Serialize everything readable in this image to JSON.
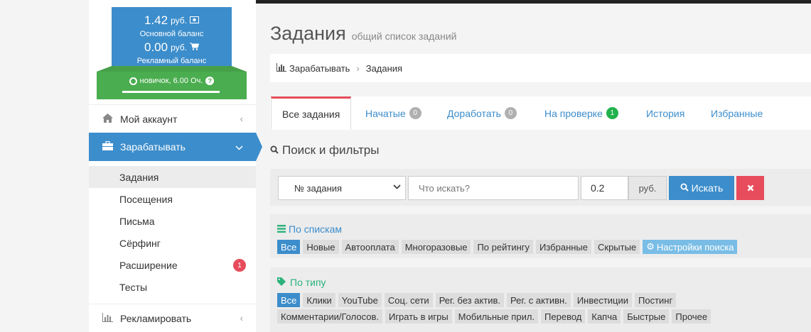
{
  "balance": {
    "main_amount": "1.42",
    "main_unit": "руб.",
    "main_label": "Основной баланс",
    "ad_amount": "0.00",
    "ad_unit": "руб.",
    "ad_label": "Рекламный баланс"
  },
  "level": {
    "text": "новичок, 6.00 Оч.",
    "progress": 0.0
  },
  "sidebar": {
    "account": "Мой аккаунт",
    "earn": "Зарабатывать",
    "advertise": "Рекламировать",
    "submenu": [
      {
        "label": "Задания",
        "active": true
      },
      {
        "label": "Посещения"
      },
      {
        "label": "Письма"
      },
      {
        "label": "Сёрфинг"
      },
      {
        "label": "Расширение",
        "badge": "1"
      },
      {
        "label": "Тесты"
      }
    ]
  },
  "page": {
    "title": "Задания",
    "subtitle": "общий список заданий"
  },
  "breadcrumb": {
    "root": "Зарабатывать",
    "current": "Задания"
  },
  "tabs": [
    {
      "label": "Все задания"
    },
    {
      "label": "Начатые",
      "badge": "0"
    },
    {
      "label": "Доработать",
      "badge": "0"
    },
    {
      "label": "На проверке",
      "badge": "1"
    },
    {
      "label": "История"
    },
    {
      "label": "Избранные"
    }
  ],
  "filters": {
    "title": "Поиск и фильтры",
    "select_value": "№ задания",
    "search_placeholder": "Что искать?",
    "price_value": "0.2",
    "unit": "руб.",
    "search_button": "Искать"
  },
  "lists_panel": {
    "title": "По спискам",
    "chips": [
      "Все",
      "Новые",
      "Автооплата",
      "Многоразовые",
      "По рейтингу",
      "Избранные",
      "Скрытые"
    ],
    "settings": "Настройки поиска"
  },
  "type_panel": {
    "title": "По типу",
    "chips": [
      "Все",
      "Клики",
      "YouTube",
      "Соц. сети",
      "Рег. без актив.",
      "Рег. с активн.",
      "Инвестиции",
      "Постинг",
      "Комментарии/Голосов.",
      "Играть в игры",
      "Мобильные прил.",
      "Перевод",
      "Капча",
      "Быстрые",
      "Прочее"
    ]
  },
  "colors": {
    "primary": "#3c8dcb",
    "success": "#4aad4f",
    "danger": "#e74c5c",
    "teal": "#2ab27b"
  }
}
